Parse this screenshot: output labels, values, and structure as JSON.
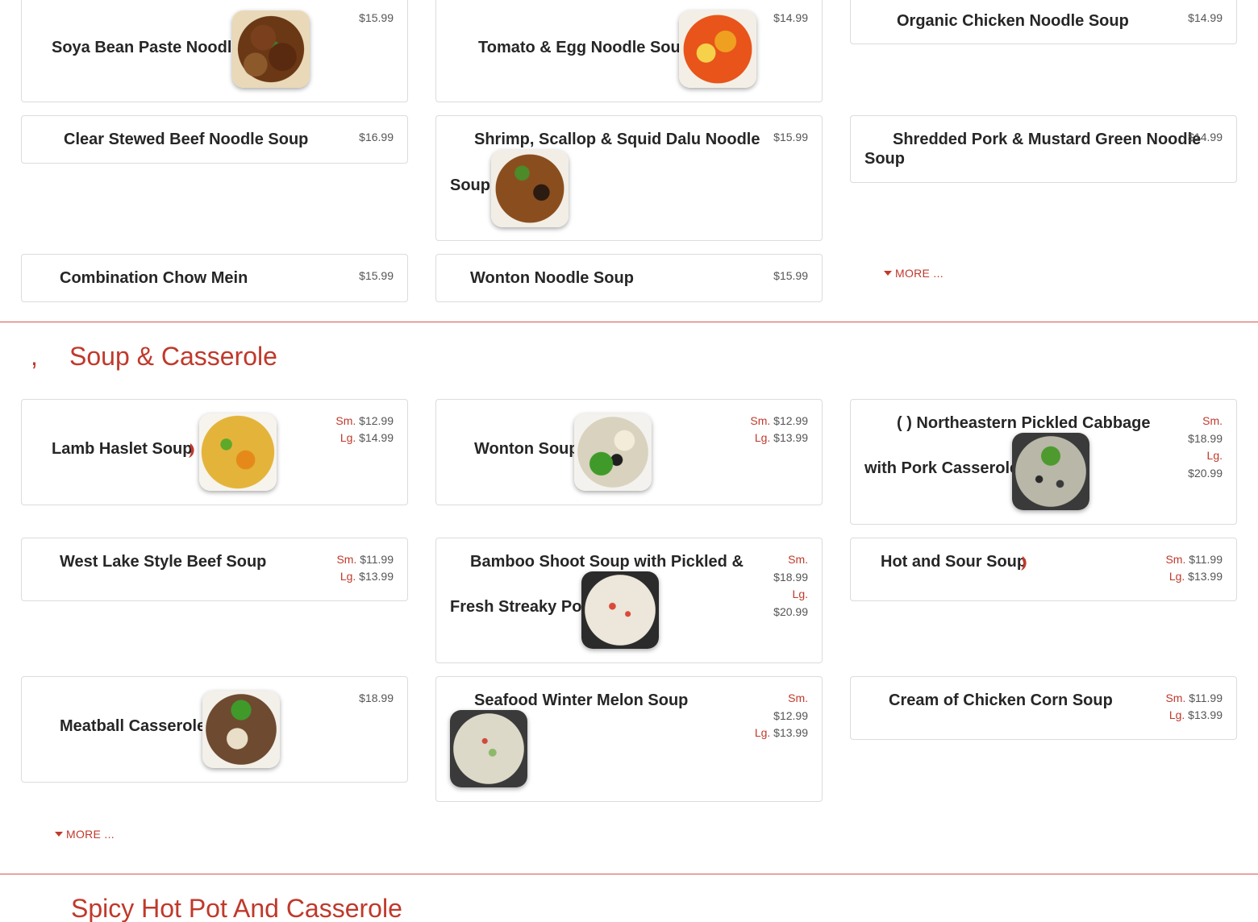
{
  "colors": {
    "accent": "#c0392b",
    "card_border": "#dcdcdc",
    "divider": "#d9534f"
  },
  "noodles": {
    "items": [
      {
        "name": "Soya Bean Paste Noodle",
        "price": "$15.99"
      },
      {
        "name": "Tomato & Egg Noodle Soup",
        "price": "$14.99"
      },
      {
        "name": "Organic Chicken Noodle Soup",
        "price": "$14.99"
      },
      {
        "name": "Clear Stewed Beef Noodle Soup",
        "price": "$16.99"
      },
      {
        "name_line1": "Shrimp, Scallop & Squid Dalu Noodle",
        "name_line2": "Soup",
        "price": "$15.99"
      },
      {
        "name_line1": "Shredded Pork & Mustard Green Noodle",
        "name_line2": "Soup",
        "price": "$14.99"
      },
      {
        "name": "Combination Chow Mein",
        "price": "$15.99"
      },
      {
        "name": "Wonton Noodle Soup",
        "price": "$15.99"
      }
    ],
    "more_label": "MORE ..."
  },
  "soup": {
    "prefix": ",",
    "title": "Soup & Casserole",
    "size_small": "Sm.",
    "size_large": "Lg.",
    "items": [
      {
        "name": "Lamb Haslet Soup",
        "spicy": true,
        "sm": "$12.99",
        "lg": "$14.99"
      },
      {
        "name": "Wonton Soup",
        "sm": "$12.99",
        "lg": "$13.99"
      },
      {
        "name_line1": "( ) Northeastern Pickled Cabbage",
        "name_line2": "with Pork Casserole",
        "sm": "$18.99",
        "lg": "$20.99"
      },
      {
        "name": "West Lake Style Beef Soup",
        "sm": "$11.99",
        "lg": "$13.99"
      },
      {
        "name_line1": "Bamboo Shoot Soup with Pickled &",
        "name_line2": "Fresh Streaky Pot",
        "sm": "$18.99",
        "lg": "$20.99"
      },
      {
        "name": "Hot and Sour Soup",
        "spicy": true,
        "sm": "$11.99",
        "lg": "$13.99"
      },
      {
        "name": "Meatball Casserole",
        "price": "$18.99"
      },
      {
        "name": "Seafood Winter Melon Soup",
        "sm": "$12.99",
        "lg": "$13.99"
      },
      {
        "name": "Cream of Chicken Corn Soup",
        "sm": "$11.99",
        "lg": "$13.99"
      }
    ],
    "more_label": "MORE ..."
  },
  "next_section": {
    "title": "Spicy Hot Pot And Casserole"
  },
  "icons": {
    "spicy": "chili-pepper-icon",
    "more": "caret-down-icon"
  }
}
